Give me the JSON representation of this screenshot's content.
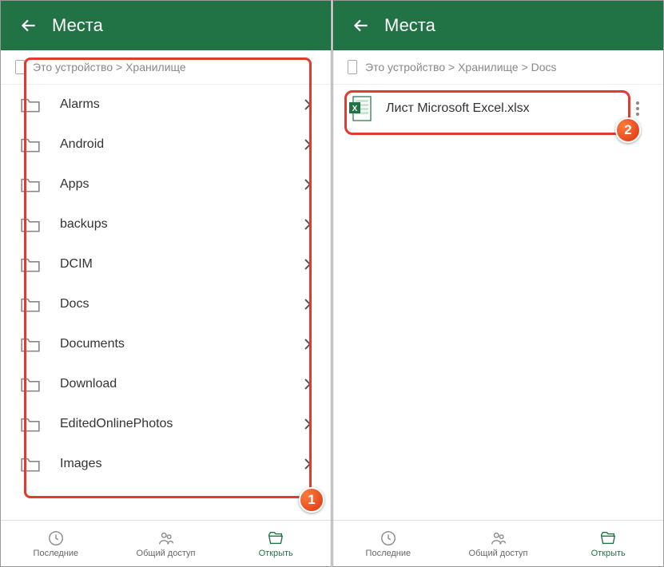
{
  "left": {
    "header_title": "Места",
    "breadcrumb": "Это устройство > Хранилище",
    "folders": [
      {
        "name": "Alarms"
      },
      {
        "name": "Android"
      },
      {
        "name": "Apps"
      },
      {
        "name": "backups"
      },
      {
        "name": "DCIM"
      },
      {
        "name": "Docs"
      },
      {
        "name": "Documents"
      },
      {
        "name": "Download"
      },
      {
        "name": "EditedOnlinePhotos"
      },
      {
        "name": "Images"
      }
    ]
  },
  "right": {
    "header_title": "Места",
    "breadcrumb": "Это устройство > Хранилище > Docs",
    "file_name": "Лист Microsoft Excel.xlsx"
  },
  "nav": {
    "recent": "Последние",
    "shared": "Общий доступ",
    "open": "Открыть"
  },
  "markers": {
    "one": "1",
    "two": "2"
  }
}
